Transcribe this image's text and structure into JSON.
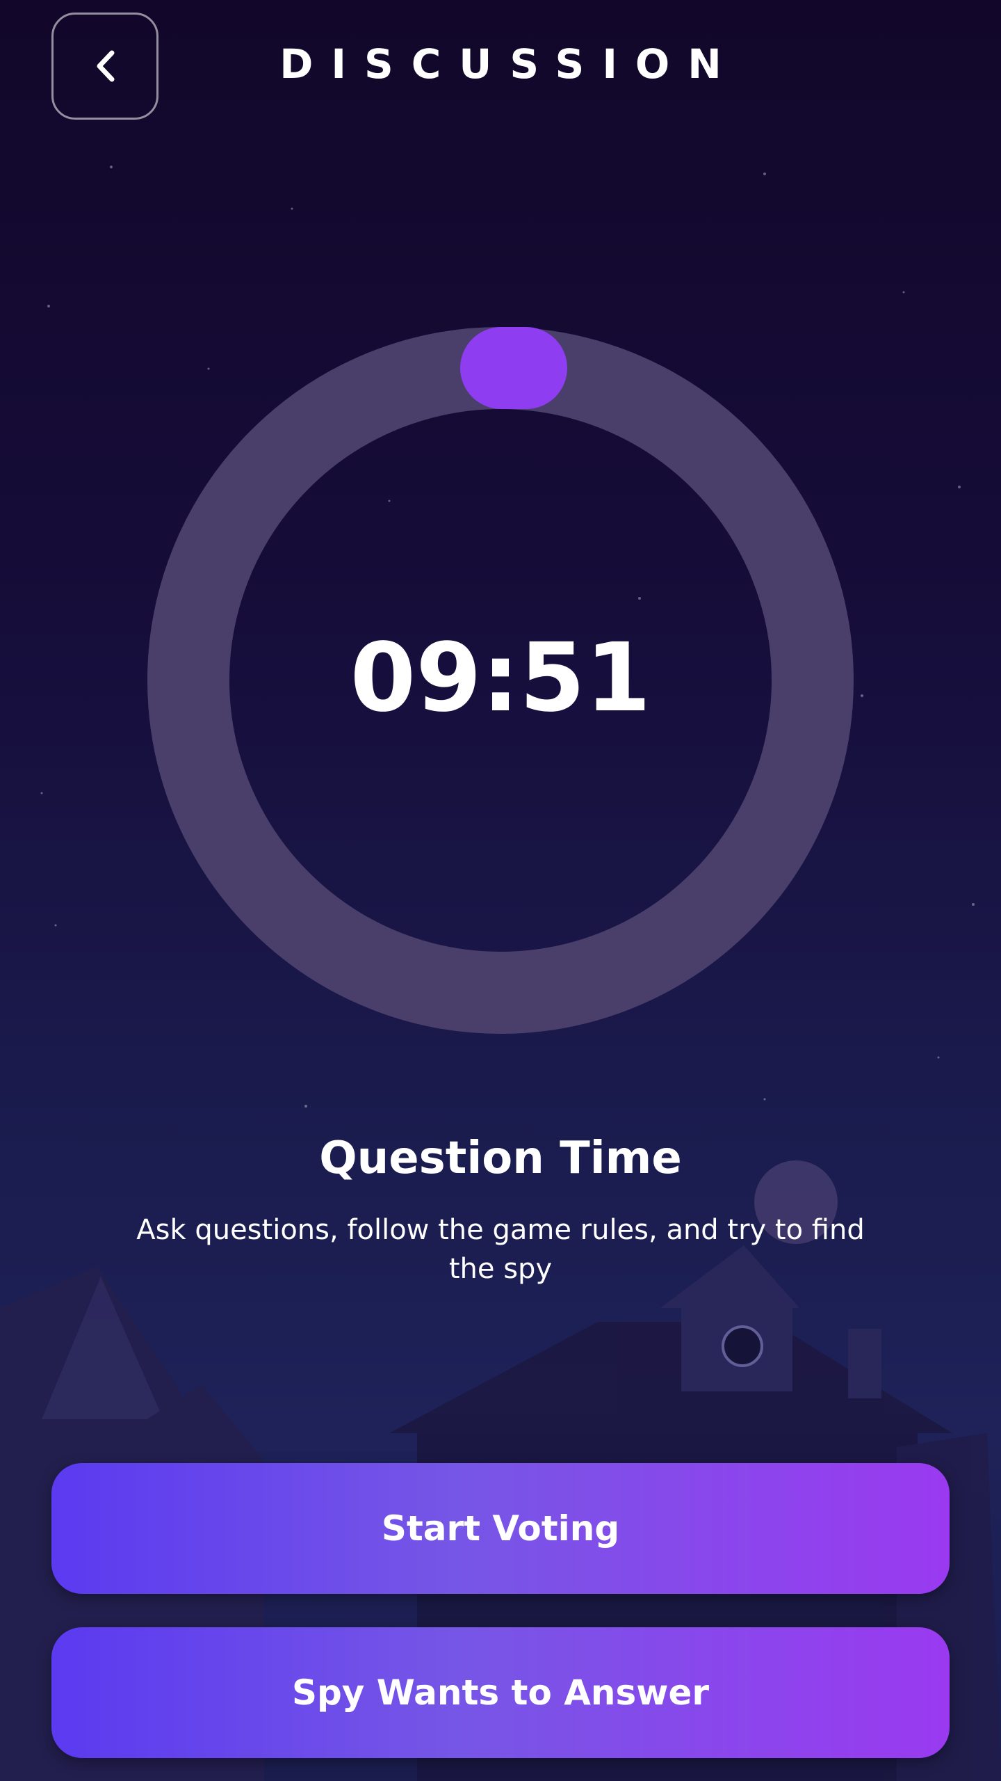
{
  "header": {
    "title": "DISCUSSION",
    "back_icon": "chevron-left-icon"
  },
  "timer": {
    "value": "09:51",
    "progress": 0.0,
    "ring_color": "#4a3f6b",
    "knob_color": "#8e3df0"
  },
  "info": {
    "heading": "Question Time",
    "body": "Ask questions, follow the game rules, and try to find the spy"
  },
  "actions": {
    "start_voting": "Start Voting",
    "spy_answer": "Spy Wants to Answer"
  },
  "colors": {
    "accent_start": "#5b3af0",
    "accent_end": "#9a3af0",
    "background": "#160d3a"
  }
}
